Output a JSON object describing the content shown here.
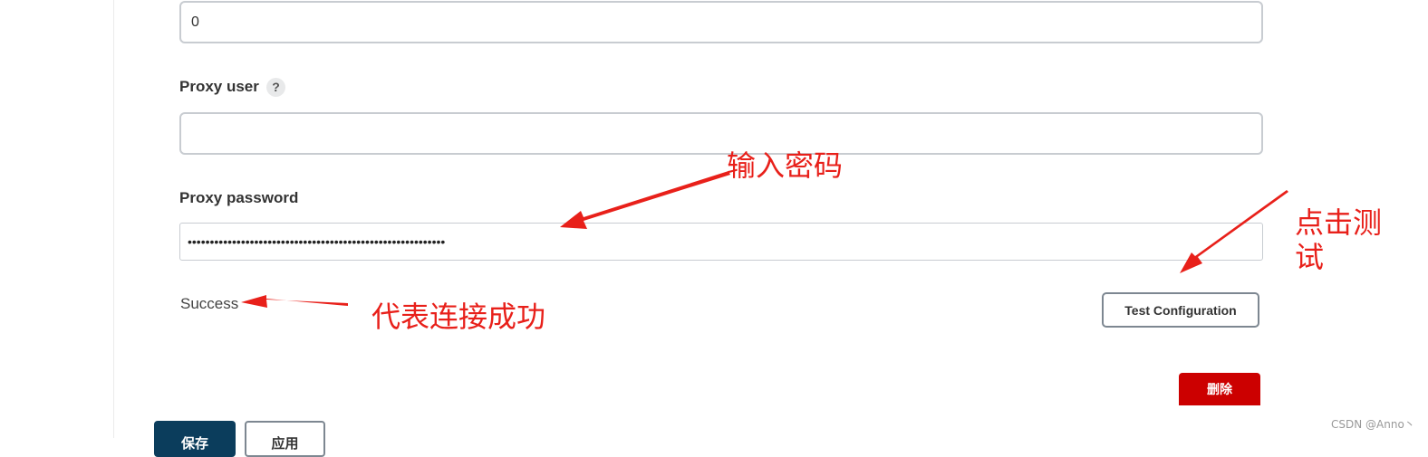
{
  "form": {
    "port_value": "0",
    "user_label": "Proxy user",
    "help_glyph": "?",
    "user_value": "",
    "password_label": "Proxy password",
    "password_masked": "••••••••••••••••••••••••••••••••••••••••••••••••••••••••••",
    "status": "Success",
    "test_button_label": "Test Configuration",
    "delete_button_label": "删除",
    "save_button_label": "保存",
    "apply_button_label": "应用"
  },
  "annotations": {
    "password_note": "输入密码",
    "success_note": "代表连接成功",
    "test_note": "点击测试",
    "color": "#e8201a"
  },
  "watermark": "CSDN @Anno丶",
  "colors": {
    "delete": "#cc0000",
    "save": "#0b3d5c"
  }
}
